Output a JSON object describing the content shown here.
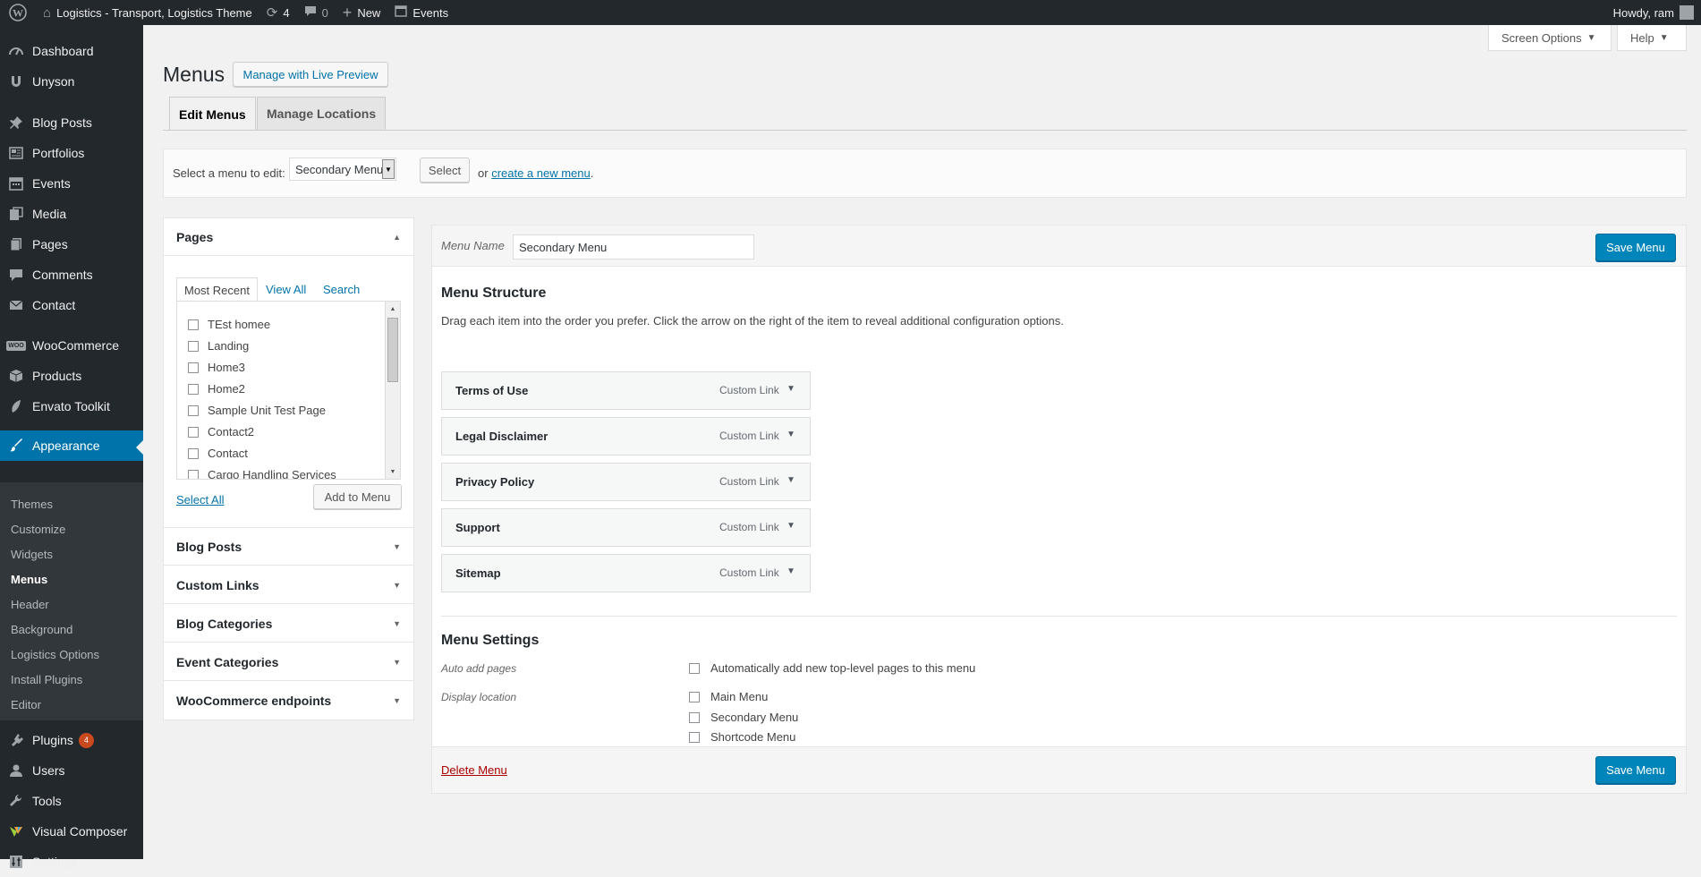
{
  "adminbar": {
    "site_name": "Logistics - Transport, Logistics Theme",
    "updates_count": "4",
    "comments_count": "0",
    "new_label": "New",
    "events_label": "Events",
    "howdy": "Howdy, ram"
  },
  "sidebar": {
    "dashboard": "Dashboard",
    "unyson": "Unyson",
    "blog_posts": "Blog Posts",
    "portfolios": "Portfolios",
    "events": "Events",
    "media": "Media",
    "pages": "Pages",
    "comments": "Comments",
    "contact": "Contact",
    "woocommerce": "WooCommerce",
    "woocommerce_icon_text": "WOO",
    "products": "Products",
    "envato": "Envato Toolkit",
    "appearance": "Appearance",
    "submenu": {
      "themes": "Themes",
      "customize": "Customize",
      "widgets": "Widgets",
      "menus": "Menus",
      "header": "Header",
      "background": "Background",
      "logistics_options": "Logistics Options",
      "install_plugins": "Install Plugins",
      "editor": "Editor"
    },
    "plugins": "Plugins",
    "plugins_badge": "4",
    "users": "Users",
    "tools": "Tools",
    "visual_composer": "Visual Composer",
    "settings": "Settings"
  },
  "screen_meta": {
    "screen_options": "Screen Options",
    "help": "Help"
  },
  "page": {
    "title": "Menus",
    "live_preview": "Manage with Live Preview",
    "tab_edit": "Edit Menus",
    "tab_locations": "Manage Locations"
  },
  "select_menu": {
    "label": "Select a menu to edit:",
    "selected": "Secondary Menu",
    "select_button": "Select",
    "or_text": "or",
    "create_link": "create a new menu",
    "period": "."
  },
  "pages_box": {
    "title": "Pages",
    "tab_recent": "Most Recent",
    "tab_view_all": "View All",
    "tab_search": "Search",
    "items": [
      "TEst homee",
      "Landing",
      "Home3",
      "Home2",
      "Sample Unit Test Page",
      "Contact2",
      "Contact",
      "Cargo Handling Services"
    ],
    "select_all": "Select All",
    "add_button": "Add to Menu"
  },
  "other_boxes": {
    "blog_posts": "Blog Posts",
    "custom_links": "Custom Links",
    "blog_categories": "Blog Categories",
    "event_categories": "Event Categories",
    "woo_endpoints": "WooCommerce endpoints"
  },
  "editor": {
    "menu_name_label": "Menu Name",
    "menu_name_value": "Secondary Menu",
    "save_button": "Save Menu",
    "structure_title": "Menu Structure",
    "structure_desc": "Drag each item into the order you prefer. Click the arrow on the right of the item to reveal additional configuration options.",
    "items": [
      {
        "title": "Terms of Use",
        "type": "Custom Link"
      },
      {
        "title": "Legal Disclaimer",
        "type": "Custom Link"
      },
      {
        "title": "Privacy Policy",
        "type": "Custom Link"
      },
      {
        "title": "Support",
        "type": "Custom Link"
      },
      {
        "title": "Sitemap",
        "type": "Custom Link"
      }
    ],
    "settings_title": "Menu Settings",
    "auto_add_label": "Auto add pages",
    "auto_add_option": "Automatically add new top-level pages to this menu",
    "display_location_label": "Display location",
    "locations": [
      "Main Menu",
      "Secondary Menu",
      "Shortcode Menu"
    ],
    "delete_link": "Delete Menu"
  },
  "colors": {
    "adminbar_bg": "#23282d",
    "accent": "#0073aa",
    "primary_button": "#0085ba",
    "badge": "#ca4a1f",
    "delete_link": "#a00"
  }
}
